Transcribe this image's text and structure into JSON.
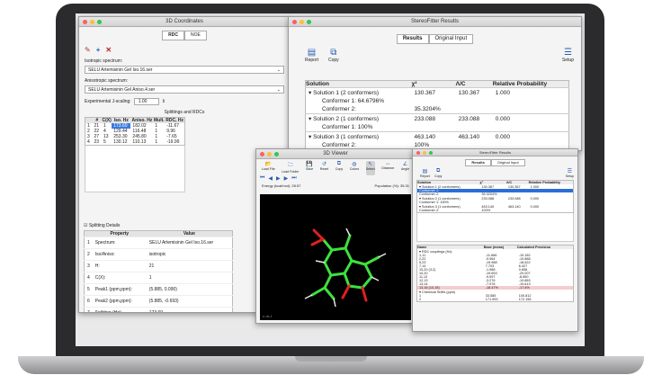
{
  "rdc_window": {
    "title": "3D Coordinates",
    "tabs": [
      "RDC",
      "NOE"
    ],
    "isotropic_label": "Isotropic spectrum:",
    "isotropic_value": "SELU Artemisinin Gel Iso.16.ser",
    "anisotropic_label": "Anisotropic spectrum:",
    "anisotropic_value": "SELU Artemisinin Gel Aniso.4.ser",
    "jscaling_label": "Experimental J-scaling:",
    "jscaling_value": "1.00",
    "splittings_title": "Splittings and RDCs",
    "columns": [
      "#",
      "C(X)",
      "Iso. Hz",
      "Aniso. Hz",
      "Mult.",
      "RDC, Hz"
    ],
    "rows": [
      [
        "1",
        "21",
        "1",
        "173.60",
        "182.02",
        "1",
        "-11.67"
      ],
      [
        "2",
        "22",
        "4",
        "129.44",
        "116.48",
        "1",
        "9.96"
      ],
      [
        "3",
        "27",
        "13",
        "253.30",
        "245.80",
        "1",
        "-7.65"
      ],
      [
        "4",
        "23",
        "5",
        "130.12",
        "110.13",
        "1",
        "-19.99"
      ]
    ],
    "details_title": "Splitting Details",
    "details_columns": [
      "Property",
      "Value"
    ],
    "details": [
      [
        "1",
        "Spectrum:",
        "SELU Artemisinin Gel Iso.16.ser"
      ],
      [
        "2",
        "Iso/Aniso:",
        "isotropic"
      ],
      [
        "3",
        "H:",
        "21"
      ],
      [
        "4",
        "C(X):",
        "1"
      ],
      [
        "5",
        "Peak1 (ppm,ppm):",
        "(5.885, 0.090)"
      ],
      [
        "6",
        "Peak2 (ppm,ppm):",
        "(5.885, -0.693)"
      ],
      [
        "7",
        "Splitting (Hz):",
        "173.60"
      ]
    ]
  },
  "results_window": {
    "title": "StereoFitter Results",
    "tabs": [
      "Results",
      "Original Input"
    ],
    "buttons": [
      "Report",
      "Copy",
      "Setup"
    ],
    "columns": [
      "Solution",
      "χ²",
      "Λ/C",
      "Relative Probability"
    ],
    "rows": [
      {
        "label": "Solution 1 (2 conformers)",
        "c1": "130.367",
        "c2": "130.367",
        "c3": "1.000",
        "group": true
      },
      {
        "label": "Conformer 1: 64.6796%",
        "c1": "",
        "c2": "",
        "c3": "",
        "group": false
      },
      {
        "label": "Conformer 2:",
        "c1": "35.3204%",
        "c2": "",
        "c3": "",
        "group": false
      },
      {
        "label": "Solution 2 (1 conformers)",
        "c1": "233.088",
        "c2": "233.088",
        "c3": "0.000",
        "group": true
      },
      {
        "label": "Conformer 1: 100%",
        "c1": "",
        "c2": "",
        "c3": "",
        "group": false
      },
      {
        "label": "Solution 3 (1 conformers)",
        "c1": "463.140",
        "c2": "463.140",
        "c3": "0.000",
        "group": true
      },
      {
        "label": "Conformer 2:",
        "c1": "100%",
        "c2": "",
        "c3": "",
        "group": false
      }
    ]
  },
  "viewer_window": {
    "title": "3D Viewer",
    "tools": [
      "Load File",
      "Load Folder",
      "Save",
      "Reset",
      "Copy",
      "Colors",
      "Select",
      "Distance",
      "Angle"
    ],
    "energy_label": "Energy (kcal/mol):",
    "energy_value": "28.57",
    "population_label": "Population (%):",
    "population_value": "35.31",
    "corner": "n.ds.1"
  },
  "results_small": {
    "title": "StereoFitter Results",
    "tabs": [
      "Results",
      "Original Input"
    ],
    "buttons": [
      "Report",
      "Copy",
      "Setup"
    ],
    "columns": [
      "Solution",
      "χ²",
      "Λ/C",
      "Relative Probability"
    ],
    "rows": [
      [
        "▾ Solution 1 (2 conformers)",
        "130.367",
        "130.367",
        "1.000"
      ],
      [
        "Conformer 1:",
        "",
        "",
        ""
      ],
      [
        "Conformer 2:",
        "35.3204%",
        "",
        ""
      ],
      [
        "▾ Solution 2 (1 conformers)",
        "233.088",
        "233.088",
        "0.000"
      ],
      [
        "Conformer 1: 100%",
        "",
        "",
        ""
      ],
      [
        "▾ Solution 3 (1 conformers)",
        "463.140",
        "463.140",
        "0.000"
      ],
      [
        "Conformer 2:",
        "100%",
        "",
        ""
      ]
    ],
    "bottom_columns": [
      "Name",
      "Base (meas)",
      "Calculated Precision"
    ],
    "bottom_rows": [
      [
        "▾ RDC couplings (Hz)",
        "",
        ""
      ],
      [
        "1,11",
        "-11.666",
        "-10.182"
      ],
      [
        "2,22",
        "-9.964",
        "-10.888"
      ],
      [
        "5,23",
        "-19.988",
        "-18.622"
      ],
      [
        "7,14",
        "7.703",
        "6.427"
      ],
      [
        "10,20 (3,2)",
        "-1.988",
        "0.658"
      ],
      [
        "10,20",
        "-19.653",
        "-20.007"
      ],
      [
        "11,12",
        "-9.597",
        "-8.890"
      ],
      [
        "12,13",
        "-3.276",
        "-10.883"
      ],
      [
        "13,14",
        "-7.976",
        "-19.613"
      ],
      [
        "13,16 (10,15)",
        "-18.47%",
        "-17.4%"
      ],
      [
        "▾ Chemical Shifts (ppm)",
        "",
        ""
      ],
      [
        "1",
        "33.585",
        "100.812"
      ],
      [
        "2",
        "171.993",
        "172.156"
      ]
    ]
  }
}
